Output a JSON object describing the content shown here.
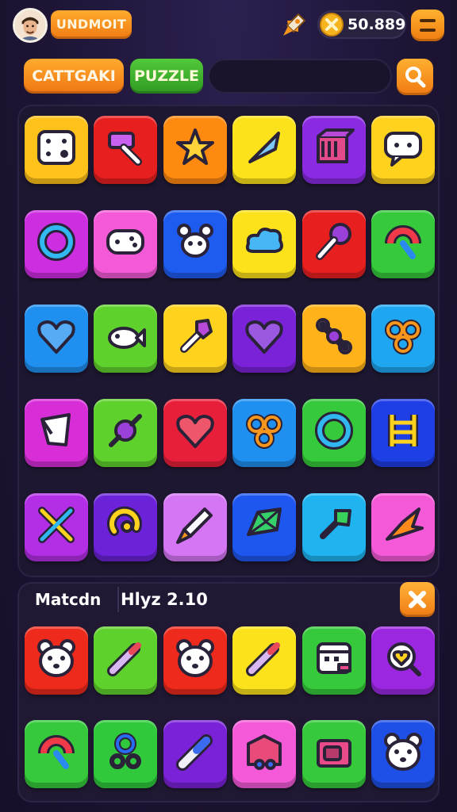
{
  "header": {
    "player_name": "UNDMOIT",
    "coin_value": "50.889",
    "avatar_icon": "player-avatar",
    "boost_icon": "rocket-icon",
    "coin_icon": "coin-icon",
    "menu_icon": "menu-icon"
  },
  "tabs": {
    "category_label": "CATTGAKI",
    "puzzle_label": "PUZZLE",
    "search_placeholder": "",
    "search_icon": "search-icon"
  },
  "colors": {
    "orange": "#f7901e",
    "green": "#52c93a",
    "background": "#1f1636"
  },
  "board": {
    "tiles": [
      {
        "color": "#ffc21a",
        "icon": "dice-icon"
      },
      {
        "color": "#e81f1f",
        "icon": "hammer-icon"
      },
      {
        "color": "#ff8a10",
        "icon": "star-icon"
      },
      {
        "color": "#fbe21a",
        "icon": "arrow-icon"
      },
      {
        "color": "#8a2be2",
        "icon": "cube-icon"
      },
      {
        "color": "#ffd21e",
        "icon": "chat-icon"
      },
      {
        "color": "#cc2ee0",
        "icon": "ring-icon"
      },
      {
        "color": "#f45ad8",
        "icon": "gamepad-icon"
      },
      {
        "color": "#1e5cf0",
        "icon": "paw-icon"
      },
      {
        "color": "#fbe21a",
        "icon": "cloud-icon"
      },
      {
        "color": "#e81f1f",
        "icon": "lollipop-icon"
      },
      {
        "color": "#35c93b",
        "icon": "magnet-icon"
      },
      {
        "color": "#1f8ff0",
        "icon": "heart-icon"
      },
      {
        "color": "#5fd12c",
        "icon": "fish-icon"
      },
      {
        "color": "#ffd21e",
        "icon": "wrench-icon"
      },
      {
        "color": "#7a22d8",
        "icon": "heart-icon"
      },
      {
        "color": "#ffb21a",
        "icon": "bone-icon"
      },
      {
        "color": "#1fa6f0",
        "icon": "pretzel-icon"
      },
      {
        "color": "#d72ed8",
        "icon": "flag-icon"
      },
      {
        "color": "#5fd12c",
        "icon": "candy-icon"
      },
      {
        "color": "#e81f3a",
        "icon": "heart-icon"
      },
      {
        "color": "#1f8ff0",
        "icon": "pretzel-icon"
      },
      {
        "color": "#35c93b",
        "icon": "ring-icon"
      },
      {
        "color": "#1e3ee6",
        "icon": "ladder-icon"
      },
      {
        "color": "#b22fe6",
        "icon": "tools-icon"
      },
      {
        "color": "#6b22d8",
        "icon": "swirl-icon"
      },
      {
        "color": "#d577f5",
        "icon": "rocket-icon"
      },
      {
        "color": "#1e56f0",
        "icon": "gem-icon"
      },
      {
        "color": "#1fb4f0",
        "icon": "leaf-icon"
      },
      {
        "color": "#f45ad8",
        "icon": "bird-icon"
      }
    ]
  },
  "match_panel": {
    "match_label": "Matcdn",
    "hint_label": "Hlyz 2.10",
    "close_icon": "close-icon",
    "tiles": [
      {
        "color": "#ee2a1c",
        "icon": "bear-icon"
      },
      {
        "color": "#5fd12c",
        "icon": "pencil-icon"
      },
      {
        "color": "#ee2a1c",
        "icon": "bear-icon"
      },
      {
        "color": "#fbe21a",
        "icon": "pencil-icon"
      },
      {
        "color": "#35c93b",
        "icon": "calendar-icon"
      },
      {
        "color": "#9b28e0",
        "icon": "heart-search-icon"
      },
      {
        "color": "#35c93b",
        "icon": "magnet-icon"
      },
      {
        "color": "#2fc93b",
        "icon": "scissors-icon"
      },
      {
        "color": "#7a22d8",
        "icon": "battery-icon"
      },
      {
        "color": "#f45ad8",
        "icon": "box-icon"
      },
      {
        "color": "#35c93b",
        "icon": "camera-icon"
      },
      {
        "color": "#1e4fe6",
        "icon": "bear-icon"
      }
    ]
  }
}
